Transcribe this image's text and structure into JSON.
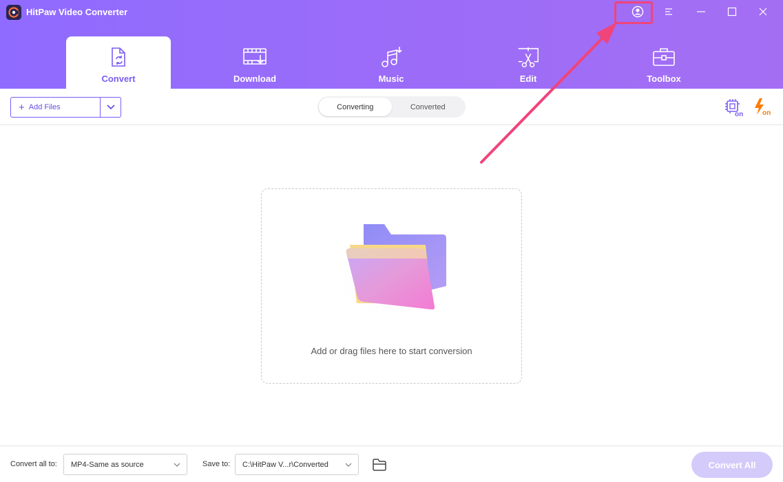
{
  "app": {
    "title": "HitPaw Video Converter"
  },
  "tabs": [
    {
      "label": "Convert",
      "icon": "convert-file-icon",
      "active": true
    },
    {
      "label": "Download",
      "icon": "film-download-icon",
      "active": false
    },
    {
      "label": "Music",
      "icon": "music-note-icon",
      "active": false
    },
    {
      "label": "Edit",
      "icon": "scissors-edit-icon",
      "active": false
    },
    {
      "label": "Toolbox",
      "icon": "toolbox-icon",
      "active": false
    }
  ],
  "window_controls": [
    "user-profile-icon",
    "menu-icon",
    "minimize-icon",
    "maximize-icon",
    "close-icon"
  ],
  "toolbar": {
    "add_files_label": "Add Files",
    "segments": [
      "Converting",
      "Converted"
    ],
    "active_segment": "Converting",
    "hardware_accel_icon": "hardware-acceleration-on-icon",
    "lightning_icon": "lightning-speed-on-icon",
    "badge_text": "on"
  },
  "dropzone": {
    "text": "Add or drag files here to start conversion"
  },
  "footer": {
    "convert_all_to_label": "Convert all to:",
    "format_value": "MP4-Same as source",
    "save_to_label": "Save to:",
    "save_path": "C:\\HitPaw V...r\\Converted",
    "convert_all_button": "Convert All"
  },
  "colors": {
    "accent": "#7b5cf5",
    "header_gradient_start": "#8f6bff",
    "header_gradient_end": "#a46ef3",
    "annotation": "#f0447a",
    "lightning": "#ff7a00",
    "convert_all_disabled": "#d4cbfb"
  }
}
